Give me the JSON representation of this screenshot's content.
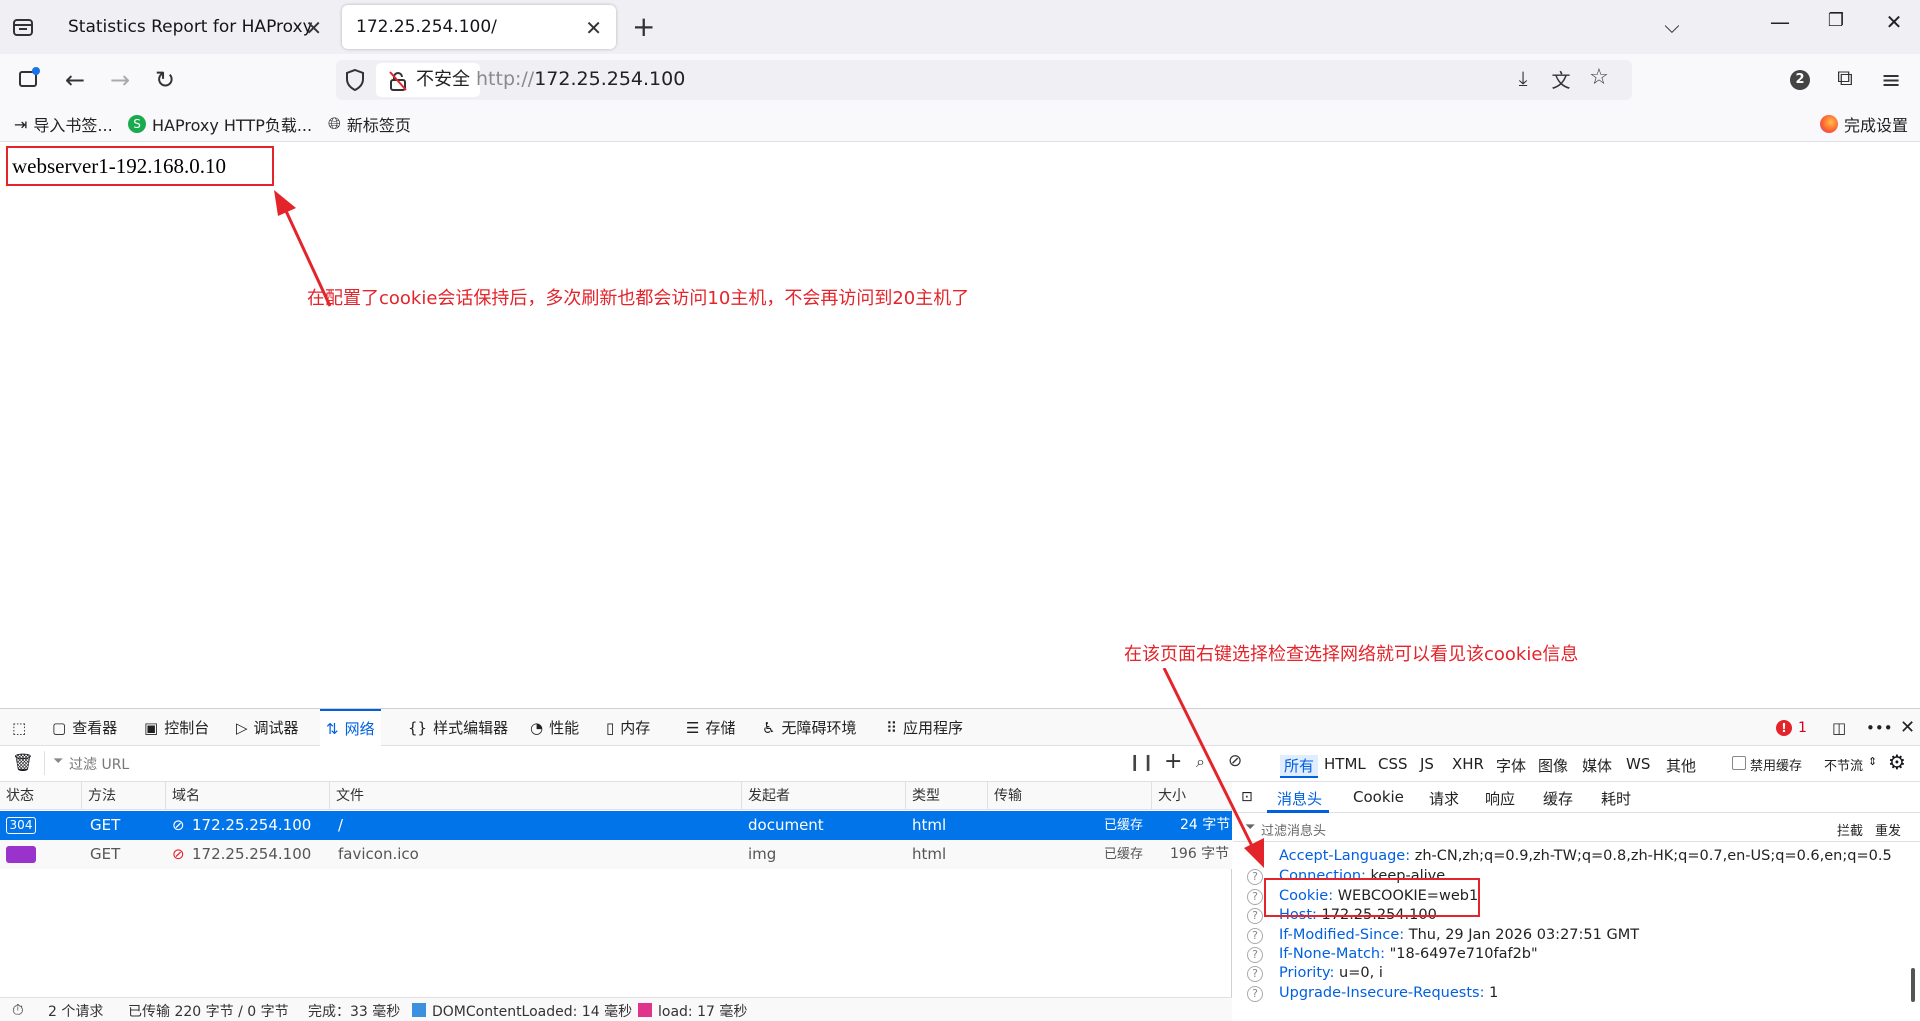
{
  "tabs": [
    {
      "title": "Statistics Report for HAProxy"
    },
    {
      "title": "172.25.254.100/"
    }
  ],
  "nav": {
    "security_label": "不安全",
    "url_protocol": "http://",
    "url_host": "172.25.254.100",
    "profile_badge": "2"
  },
  "bookmarks": {
    "items": [
      "导入书签...",
      "HAProxy HTTP负载...",
      "新标签页"
    ],
    "setup": "完成设置"
  },
  "page": {
    "body_text": "webserver1-192.168.0.10"
  },
  "annotations": {
    "top": "在配置了cookie会话保持后，多次刷新也都会访问10主机，不会再访问到20主机了",
    "bottom": "在该页面右键选择检查选择网络就可以看见该cookie信息"
  },
  "devtools": {
    "tabs": [
      "查看器",
      "控制台",
      "调试器",
      "网络",
      "样式编辑器",
      "性能",
      "内存",
      "存储",
      "无障碍环境",
      "应用程序"
    ],
    "error_count": "1",
    "filter_placeholder": "过滤 URL",
    "type_filters": [
      "所有",
      "HTML",
      "CSS",
      "JS",
      "XHR",
      "字体",
      "图像",
      "媒体",
      "WS",
      "其他"
    ],
    "disable_cache": "禁用缓存",
    "throttle": "不节流",
    "columns": [
      "状态",
      "方法",
      "域名",
      "文件",
      "发起者",
      "类型",
      "传输",
      "大小"
    ],
    "rows": [
      {
        "status": "304",
        "method": "GET",
        "domain": "172.25.254.100",
        "file": "/",
        "initiator": "document",
        "type": "html",
        "transfer": "已缓存",
        "size": "24 字节"
      },
      {
        "status": "",
        "method": "GET",
        "domain": "172.25.254.100",
        "file": "favicon.ico",
        "initiator": "img",
        "type": "html",
        "transfer": "已缓存",
        "size": "196 字节"
      }
    ],
    "status": {
      "requests": "2 个请求",
      "transferred": "已传输 220 字节 / 0 字节",
      "finish": "完成：33 毫秒",
      "dcl": "DOMContentLoaded: 14 毫秒",
      "load": "load: 17 毫秒"
    },
    "detail_tabs": [
      "消息头",
      "Cookie",
      "请求",
      "响应",
      "缓存",
      "耗时"
    ],
    "header_filter": "过滤消息头",
    "block": "拦截",
    "resend": "重发",
    "headers": [
      {
        "key": "Accept-Language:",
        "value": "zh-CN,zh;q=0.9,zh-TW;q=0.8,zh-HK;q=0.7,en-US;q=0.6,en;q=0.5"
      },
      {
        "key": "Connection:",
        "value": "keep-alive"
      },
      {
        "key": "Cookie:",
        "value": "WEBCOOKIE=web1"
      },
      {
        "key": "Host:",
        "value": "172.25.254.100"
      },
      {
        "key": "If-Modified-Since:",
        "value": "Thu, 29 Jan 2026 03:27:51 GMT"
      },
      {
        "key": "If-None-Match:",
        "value": "\"18-6497e710faf2b\""
      },
      {
        "key": "Priority:",
        "value": "u=0, i"
      },
      {
        "key": "Upgrade-Insecure-Requests:",
        "value": "1"
      }
    ]
  }
}
